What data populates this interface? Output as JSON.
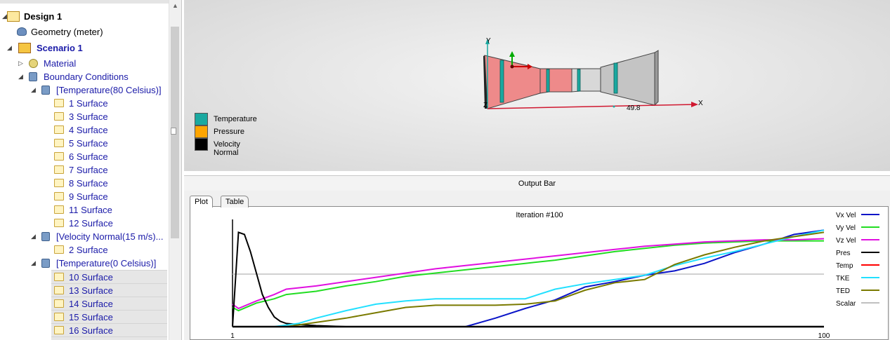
{
  "tree": {
    "design": "Design 1",
    "geometry": "Geometry (meter)",
    "scenario": "Scenario 1",
    "material": "Material",
    "boundary_conditions": "Boundary Conditions",
    "groups": [
      {
        "label": "[Temperature(80 Celsius)]",
        "surfaces": [
          "1 Surface",
          "3 Surface",
          "4 Surface",
          "5 Surface",
          "6 Surface",
          "7 Surface",
          "8 Surface",
          "9 Surface",
          "11 Surface",
          "12 Surface"
        ]
      },
      {
        "label": "[Velocity Normal(15 m/s)...",
        "surfaces": [
          "2 Surface"
        ]
      },
      {
        "label": "[Temperature(0 Celsius)]",
        "surfaces": [
          "10 Surface",
          "13 Surface",
          "14 Surface",
          "15 Surface",
          "16 Surface"
        ]
      }
    ]
  },
  "viewport": {
    "axis_labels": {
      "y": "Y",
      "x": "X",
      "z": "Z"
    },
    "dimension_label": "49.8",
    "legend": [
      {
        "label": "Temperature",
        "color": "#1aa9a0"
      },
      {
        "label": "Pressure",
        "color": "#ffa500"
      },
      {
        "label": "Velocity Normal",
        "color": "#000000"
      }
    ]
  },
  "output_bar": {
    "title": "Output Bar",
    "tabs": [
      "Plot",
      "Table"
    ],
    "active_tab": "Plot"
  },
  "chart_data": {
    "type": "line",
    "title": "Iteration #100",
    "xlim": [
      1,
      100
    ],
    "x_tick_labels": [
      "1",
      "100"
    ],
    "legend_position": "right",
    "reference_line": 0.49,
    "series": [
      {
        "name": "Vx Vel",
        "color": "#0a14c8",
        "x": [
          1,
          10,
          20,
          35,
          40,
          45,
          50,
          55,
          60,
          65,
          70,
          75,
          80,
          85,
          90,
          95,
          100
        ],
        "y": [
          0,
          0,
          0,
          0,
          0,
          0.08,
          0.17,
          0.25,
          0.37,
          0.42,
          0.48,
          0.52,
          0.59,
          0.69,
          0.77,
          0.86,
          0.9
        ]
      },
      {
        "name": "Vy Vel",
        "color": "#22dd22",
        "x": [
          1,
          2,
          5,
          8,
          10,
          15,
          20,
          25,
          30,
          35,
          40,
          45,
          50,
          55,
          60,
          65,
          70,
          75,
          80,
          85,
          90,
          95,
          100
        ],
        "y": [
          0.18,
          0.15,
          0.22,
          0.26,
          0.3,
          0.33,
          0.38,
          0.42,
          0.47,
          0.5,
          0.53,
          0.56,
          0.59,
          0.62,
          0.66,
          0.7,
          0.73,
          0.76,
          0.78,
          0.79,
          0.8,
          0.8,
          0.8
        ]
      },
      {
        "name": "Vz Vel",
        "color": "#e010e0",
        "x": [
          1,
          2,
          5,
          8,
          10,
          15,
          20,
          25,
          30,
          35,
          40,
          45,
          50,
          55,
          60,
          65,
          70,
          75,
          80,
          85,
          90,
          95,
          100
        ],
        "y": [
          0.21,
          0.17,
          0.24,
          0.3,
          0.35,
          0.38,
          0.42,
          0.46,
          0.5,
          0.54,
          0.57,
          0.6,
          0.63,
          0.66,
          0.69,
          0.72,
          0.75,
          0.77,
          0.79,
          0.8,
          0.81,
          0.81,
          0.82
        ]
      },
      {
        "name": "Pres",
        "color": "#000000",
        "x": [
          1,
          2,
          3,
          4,
          5,
          6,
          7,
          8,
          9,
          10,
          12,
          15,
          20,
          30,
          50,
          100
        ],
        "y": [
          0,
          0.88,
          0.86,
          0.7,
          0.5,
          0.3,
          0.18,
          0.09,
          0.05,
          0.03,
          0.02,
          0.01,
          0.0,
          0.0,
          0.0,
          0.0
        ]
      },
      {
        "name": "Temp",
        "color": "#ff0000",
        "x": [
          1,
          100
        ],
        "y": [
          0,
          0
        ]
      },
      {
        "name": "TKE",
        "color": "#22e0ff",
        "x": [
          1,
          8,
          12,
          15,
          20,
          25,
          30,
          35,
          40,
          45,
          50,
          55,
          60,
          65,
          70,
          75,
          80,
          85,
          90,
          95,
          100
        ],
        "y": [
          0,
          0,
          0.03,
          0.08,
          0.15,
          0.21,
          0.24,
          0.26,
          0.26,
          0.26,
          0.26,
          0.35,
          0.4,
          0.44,
          0.48,
          0.57,
          0.64,
          0.7,
          0.77,
          0.84,
          0.9
        ]
      },
      {
        "name": "TED",
        "color": "#7a7a00",
        "x": [
          1,
          10,
          15,
          20,
          25,
          30,
          35,
          40,
          45,
          50,
          55,
          60,
          65,
          70,
          75,
          80,
          85,
          90,
          95,
          100
        ],
        "y": [
          0,
          0,
          0.04,
          0.08,
          0.13,
          0.18,
          0.2,
          0.2,
          0.2,
          0.21,
          0.24,
          0.34,
          0.41,
          0.44,
          0.58,
          0.67,
          0.74,
          0.8,
          0.84,
          0.88
        ]
      },
      {
        "name": "Scalar",
        "color": "#c0c0c0",
        "x": [
          1,
          100
        ],
        "y": [
          0.49,
          0.49
        ]
      }
    ]
  }
}
